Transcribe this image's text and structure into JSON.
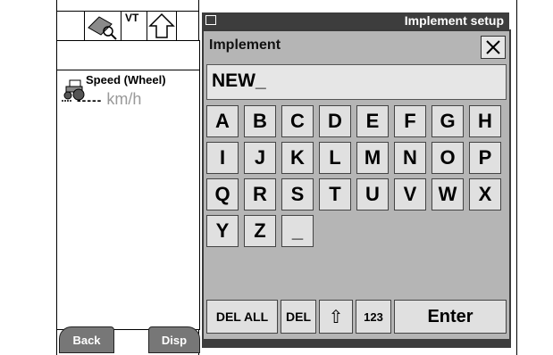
{
  "left_panel": {
    "top_icons": [
      "implement-toolkit-icon",
      "vt-icon",
      "up-arrow-icon"
    ],
    "vt_label": "VT",
    "speed_label": "Speed (Wheel)",
    "speed_dashes": "-----",
    "speed_unit": "km/h",
    "softkeys": {
      "back": "Back",
      "disp": "Disp"
    }
  },
  "header": {
    "title": "Implement setup"
  },
  "dialog": {
    "title": "Implement",
    "input_value": "NEW_",
    "keys": [
      "A",
      "B",
      "C",
      "D",
      "E",
      "F",
      "G",
      "H",
      "I",
      "J",
      "K",
      "L",
      "M",
      "N",
      "O",
      "P",
      "Q",
      "R",
      "S",
      "T",
      "U",
      "V",
      "W",
      "X",
      "Y",
      "Z",
      "_"
    ],
    "function_keys": {
      "del_all": "DEL ALL",
      "del": "DEL",
      "shift": "⇧",
      "num": "123",
      "enter": "Enter"
    }
  }
}
